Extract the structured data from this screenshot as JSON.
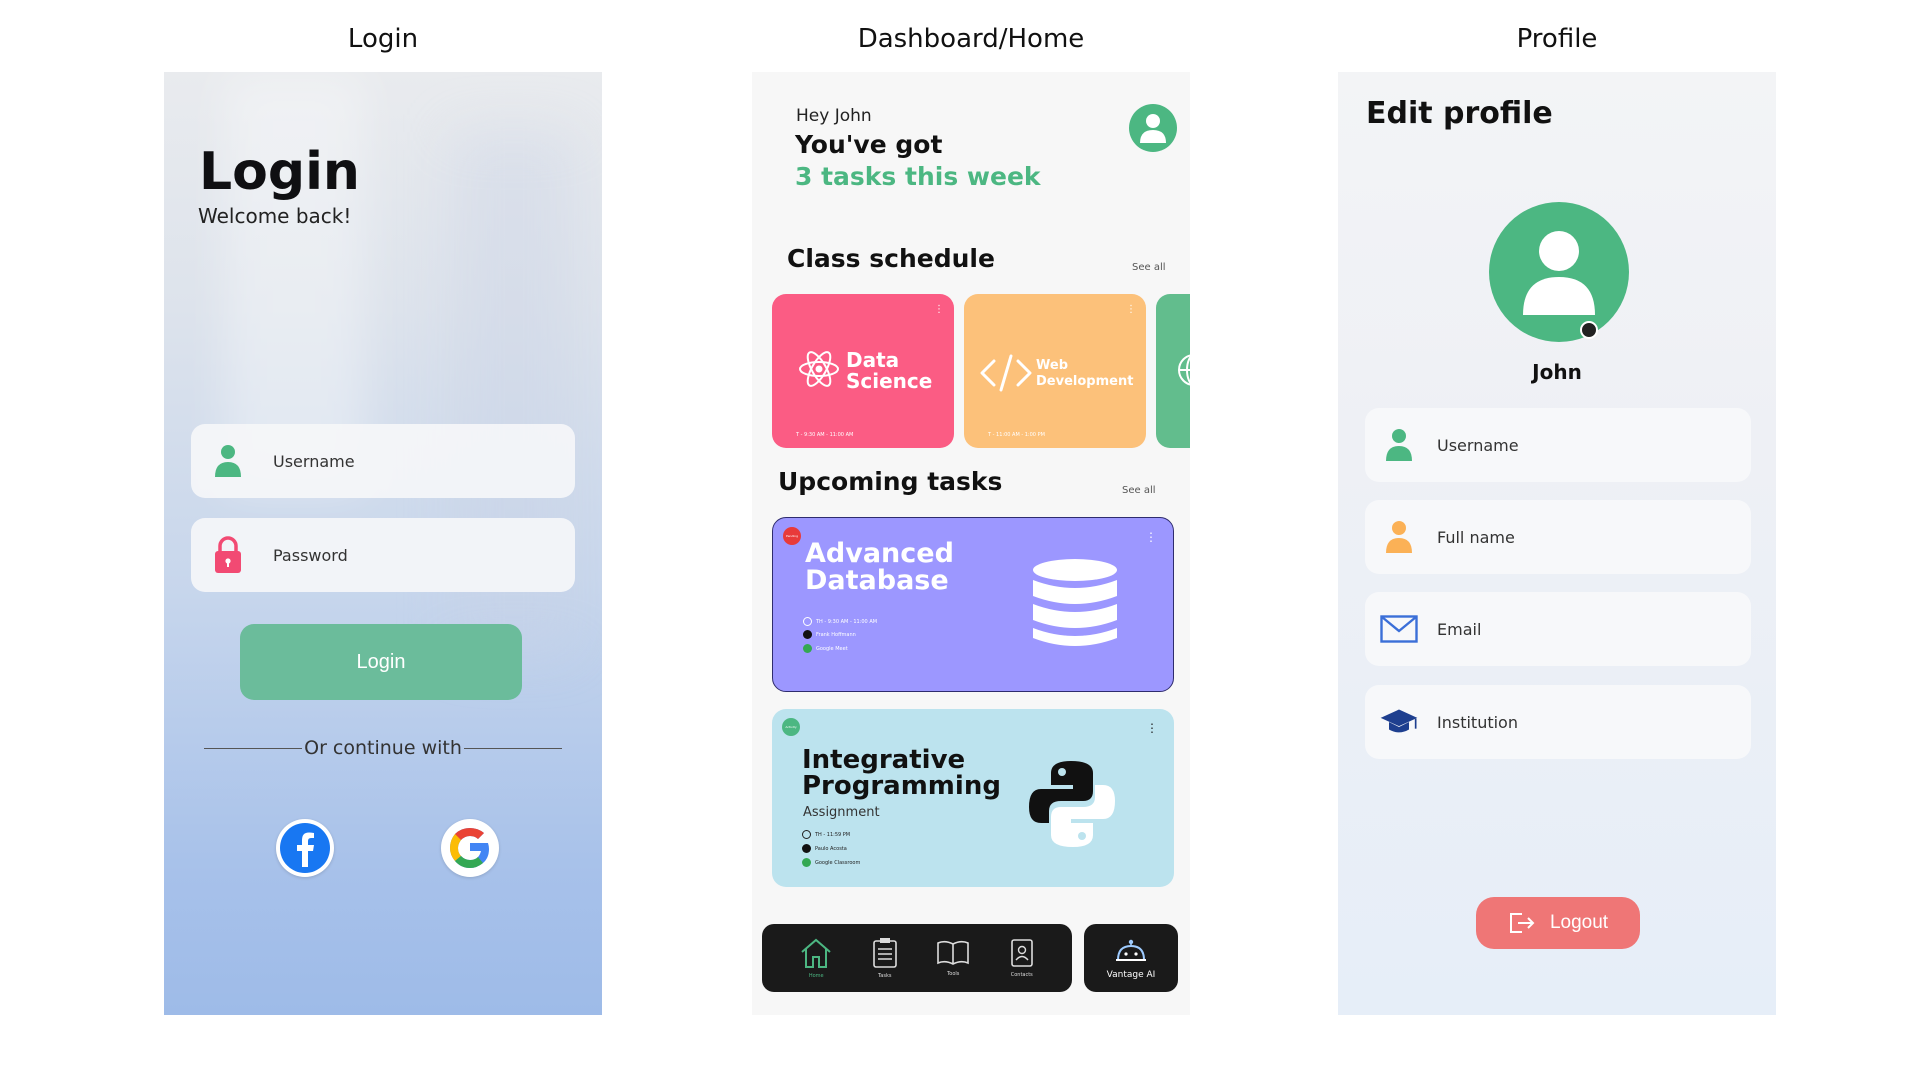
{
  "captions": {
    "login": "Login",
    "dashboard": "Dashboard/Home",
    "profile": "Profile"
  },
  "login": {
    "title": "Login",
    "subtitle": "Welcome back!",
    "username_placeholder": "Username",
    "password_placeholder": "Password",
    "login_button": "Login",
    "divider": "Or continue with",
    "social": [
      "facebook-icon",
      "google-icon"
    ],
    "accent": "#6bbc9b"
  },
  "dashboard": {
    "greeting": "Hey John",
    "headline": "You've got",
    "highlight": "3 tasks this week",
    "class_schedule": {
      "title": "Class schedule",
      "see_all": "See all",
      "cards": [
        {
          "name": "Data Science",
          "time": "T - 9:30 AM - 11:00 AM",
          "color": "#fb5c84",
          "icon": "atom-icon"
        },
        {
          "name": "Web Development",
          "time": "T - 11:00 AM - 1:00 PM",
          "color": "#fcc17a",
          "icon": "code-icon"
        },
        {
          "name": "",
          "time": "",
          "color": "#62bd8d",
          "icon": "globe-icon"
        }
      ]
    },
    "upcoming": {
      "title": "Upcoming tasks",
      "see_all": "See all",
      "tasks": [
        {
          "badge": "Pending",
          "title_line1": "Advanced",
          "title_line2": "Database",
          "subtitle": "",
          "time": "TH - 9:30 AM - 11:00 AM",
          "person": "Frank Hoffmann",
          "platform": "Google Meet",
          "color": "#9c97ff",
          "icon": "database-icon"
        },
        {
          "badge": "Activity",
          "title_line1": "Integrative",
          "title_line2": "Programming",
          "subtitle": "Assignment",
          "time": "TH - 11:59 PM",
          "person": "Paulo Acosta",
          "platform": "Google Classroom",
          "color": "#bce3ee",
          "icon": "python-icon"
        }
      ]
    },
    "nav": [
      {
        "label": "Home",
        "icon": "home-icon",
        "active": true
      },
      {
        "label": "Tasks",
        "icon": "clipboard-icon",
        "active": false
      },
      {
        "label": "Tools",
        "icon": "book-icon",
        "active": false
      },
      {
        "label": "Contacts",
        "icon": "contacts-icon",
        "active": false
      }
    ],
    "ai_button": "Vantage AI",
    "accent": "#4cb782"
  },
  "profile": {
    "title": "Edit profile",
    "name": "John",
    "fields": [
      {
        "label": "Username",
        "icon": "user-icon"
      },
      {
        "label": "Full name",
        "icon": "person-icon"
      },
      {
        "label": "Email",
        "icon": "mail-icon"
      },
      {
        "label": "Institution",
        "icon": "graduation-cap-icon"
      }
    ],
    "logout": "Logout",
    "logout_color": "#ef7676"
  }
}
